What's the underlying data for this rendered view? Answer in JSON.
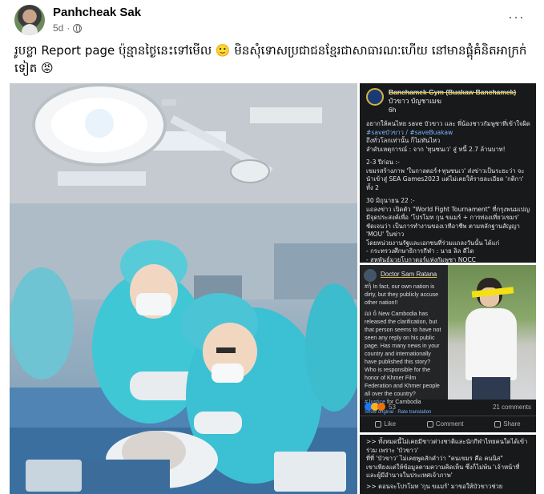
{
  "post": {
    "author": "Panhcheak Sak",
    "time": "5d",
    "text": "រូបខ្លា Report page ប៉ុន្មានថ្ងៃនេះទៅមើល 🙂 មិនសុំទោសប្រជាជនខ្មែរជាសាធារណៈហើយ នៅមានផ្ដុំគំនិតអាក្រក់ទៀត 😡",
    "more_icon": "more-horizontal-icon"
  },
  "side1": {
    "page_name": "Banchamek Gym (Buakaw Banchamek)",
    "sub_name": "บัวขาว บัญชาเมฆ",
    "time": "6h",
    "line1": "อยากให้คนไทย save บัวขาว และ พี่น้องชาวกัมพูชาที่เข้าใจผิด",
    "tags1": "#saveบัวขาว / #saveBuakaw",
    "line2": "ถึงทั่วโลกเท่านั้น ก็ไม่ทันไหว",
    "line3": "ลำดับเหตุการณ์ : จาก 'ทุนซนเว' สู่ หนี้ 2.7 ล้านบาท!",
    "p2_head": "2-3 ปีก่อน :-",
    "p2_body": "เขมรสร้างภาพ 'ในกาลตอร์+ทุนซนเว' ส่งข่าวเป็นระยะว่า จะนำเข้าสู่ SEA Games2023 แต่ไม่เคยให้รายละเอียด 'กติกา' ทั้ง 2",
    "p3_head": "30 มิถุนายน 22 :-",
    "p3_body": "แถลงข่าว เปิดตัว \"World Fight Tournament\" ที่กรุงพนมเปญ มีจุดประสงค์เพื่อ 'โปรโมท กุน ขแมร์ + การท่องเที่ยวเขมร' ชัดเจนว่า เป็นการทำงานของเวทีอาชีพ ตามหลักฐานสัญญา 'MOU' ในข่าว",
    "p3_tail": "โดยหน่วยงานรัฐและเอกชนที่ร่วมแถลงวันนั้น ได้แก่",
    "p3_list": "- กระทรวงศึกษาธิการกีฬา : นาย ลิล ดีได",
    "p3_cut": "- สหพันธ์มวยโบกาตอร์แห่งกัมพูชา NOCC"
  },
  "side2": {
    "card_name": "Doctor Sam Ratana",
    "line1": "#កុំ In fact, our own nation is dirty, but they publicly accuse other nation!!",
    "line2": "ណ ចំ New Cambodia has released the clarification, but that person seems to have not seen any reply on his public page. Has many news in your country and internationally have published this story? Who is responsible for the honor of Khmer Film Federation and Khmer people all over the country?",
    "tag": "#Justice",
    "line3": "for Cambodia",
    "show_original": "Show original · Rate translation",
    "reaction_count": "53",
    "comments": "21 comments",
    "like": "Like",
    "comment": "Comment",
    "share": "Share"
  },
  "side3": {
    "line1": ">> ทั้งหมดนี้ไม่เคยมีชาวต่างชาติและนักกีฬาไทยคนใดได้เข้าร่วม เพราะ 'บัวขาว'",
    "line2": "ที่ที่ 'บัวขาว' ไม่เคยพูดสักคำว่า \"คนเขมร คือ คนนิส\"",
    "line3": "เขาเพียงแต่ให้ข้อมูลตามความคิดเห็น ซึ่งก็ไม่พ้น 'เจ้าหน้าที่และผู้มีอำนาจในประเทศเจ้าภาพ'",
    "line4": ">> ตอนจะโปรโมท 'กุน ขแมร์' มาขอให้บัวขาวช่วย"
  },
  "colors": {
    "fb_blue": "#1877f2",
    "dark_bg": "#18191a",
    "text_gray": "#65676b"
  }
}
